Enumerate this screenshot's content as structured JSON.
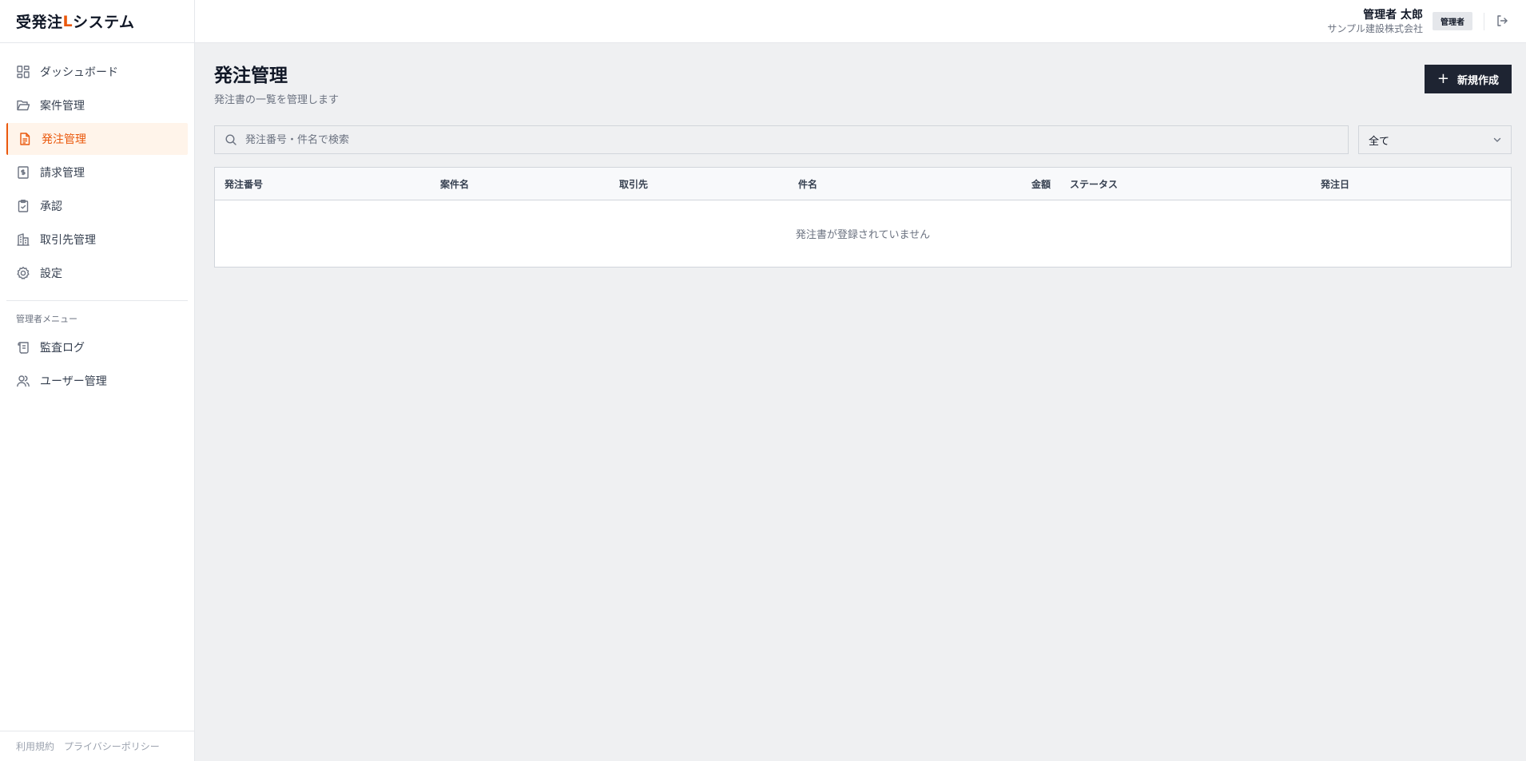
{
  "brand": {
    "prefix": "受発注",
    "accent": "L",
    "suffix": "システム",
    "accent_color": "#ea580c"
  },
  "sidebar": {
    "items": [
      {
        "label": "ダッシュボード",
        "icon": "dashboard-icon"
      },
      {
        "label": "案件管理",
        "icon": "folder-icon"
      },
      {
        "label": "発注管理",
        "icon": "document-icon",
        "active": true
      },
      {
        "label": "請求管理",
        "icon": "invoice-icon"
      },
      {
        "label": "承認",
        "icon": "clipboard-check-icon"
      },
      {
        "label": "取引先管理",
        "icon": "building-icon"
      },
      {
        "label": "設定",
        "icon": "gear-icon"
      }
    ],
    "admin_section_label": "管理者メニュー",
    "admin_items": [
      {
        "label": "監査ログ",
        "icon": "scroll-icon"
      },
      {
        "label": "ユーザー管理",
        "icon": "users-icon"
      }
    ],
    "footer": {
      "terms": "利用規約",
      "privacy": "プライバシーポリシー"
    }
  },
  "header": {
    "user_name": "管理者 太郎",
    "company": "サンプル建設株式会社",
    "role_badge": "管理者"
  },
  "page": {
    "title": "発注管理",
    "subtitle": "発注書の一覧を管理します",
    "new_button_label": "新規作成"
  },
  "filters": {
    "search_placeholder": "発注番号・件名で検索",
    "status_selected": "全て"
  },
  "table": {
    "columns": [
      "発注番号",
      "案件名",
      "取引先",
      "件名",
      "金額",
      "ステータス",
      "発注日"
    ],
    "empty_message": "発注書が登録されていません"
  }
}
